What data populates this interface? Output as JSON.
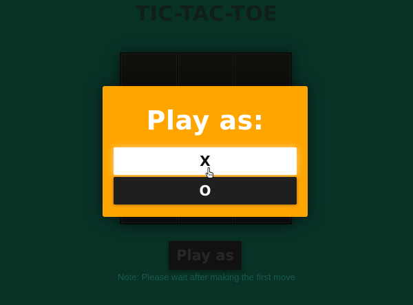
{
  "app": {
    "title": "TIC-TAC-TOE"
  },
  "board": {
    "cells": [
      "",
      "",
      "",
      "",
      "",
      "",
      "",
      "",
      ""
    ]
  },
  "controls": {
    "play_as_label": "Play as",
    "note": "Note: Please wait after making the first move"
  },
  "modal": {
    "title": "Play as:",
    "options": [
      {
        "label": "X"
      },
      {
        "label": "O"
      }
    ]
  },
  "colors": {
    "background": "#0b3b2e",
    "modal": "#ffa500",
    "option_x_bg": "#ffffff",
    "option_o_bg": "#1f1f1f"
  },
  "icons": {
    "cursor": "hand-pointer-icon"
  }
}
